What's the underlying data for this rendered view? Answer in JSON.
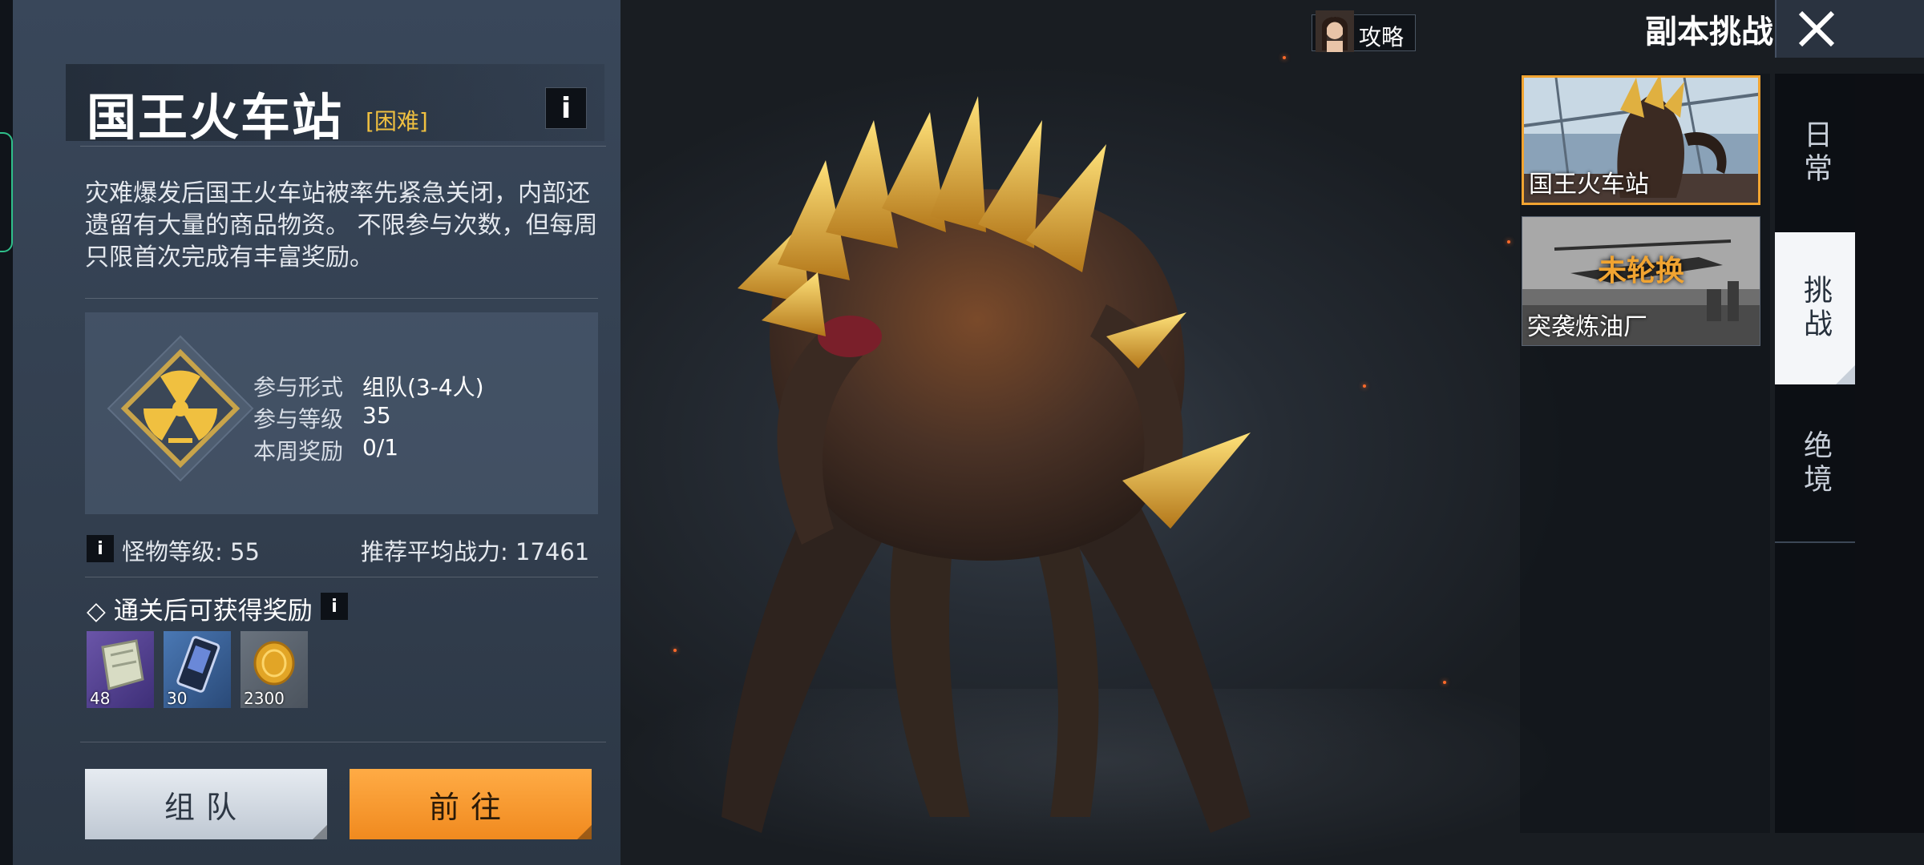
{
  "dungeon": {
    "title": "国王火车站",
    "difficulty": "[困难]",
    "info_icon": "i",
    "description": "灾难爆发后国王火车站被率先紧急关闭，内部还遗留有大量的商品物资。 不限参与次数，但每周只限首次完成有丰富奖励。",
    "participation_label": "参与形式",
    "participation_value": "组队(3-4人)",
    "level_label": "参与等级",
    "level_value": "35",
    "weekly_label": "本周奖励",
    "weekly_value": "0/1",
    "monster_level": "怪物等级: 55",
    "recommended_power": "推荐平均战力: 17461",
    "reward_title": "◇ 通关后可获得奖励",
    "rewards": [
      {
        "icon": "armor-plate-icon",
        "qty": "48"
      },
      {
        "icon": "chip-card-icon",
        "qty": "30"
      },
      {
        "icon": "gold-coin-icon",
        "qty": "2300"
      }
    ],
    "team_button": "组队",
    "go_button": "前往"
  },
  "topbar": {
    "guide_label": "攻略",
    "title": "副本挑战"
  },
  "dungeon_list": [
    {
      "name": "国王火车站",
      "selected": true
    },
    {
      "name": "突袭炼油厂",
      "overlay": "未轮换"
    }
  ],
  "side_tabs": [
    {
      "label": "日常"
    },
    {
      "label": "挑战",
      "active": true
    },
    {
      "label": "绝境"
    }
  ],
  "colors": {
    "accent_orange": "#f1a431",
    "difficulty_gold": "#f0c040",
    "panel_bg": "#39475a"
  }
}
